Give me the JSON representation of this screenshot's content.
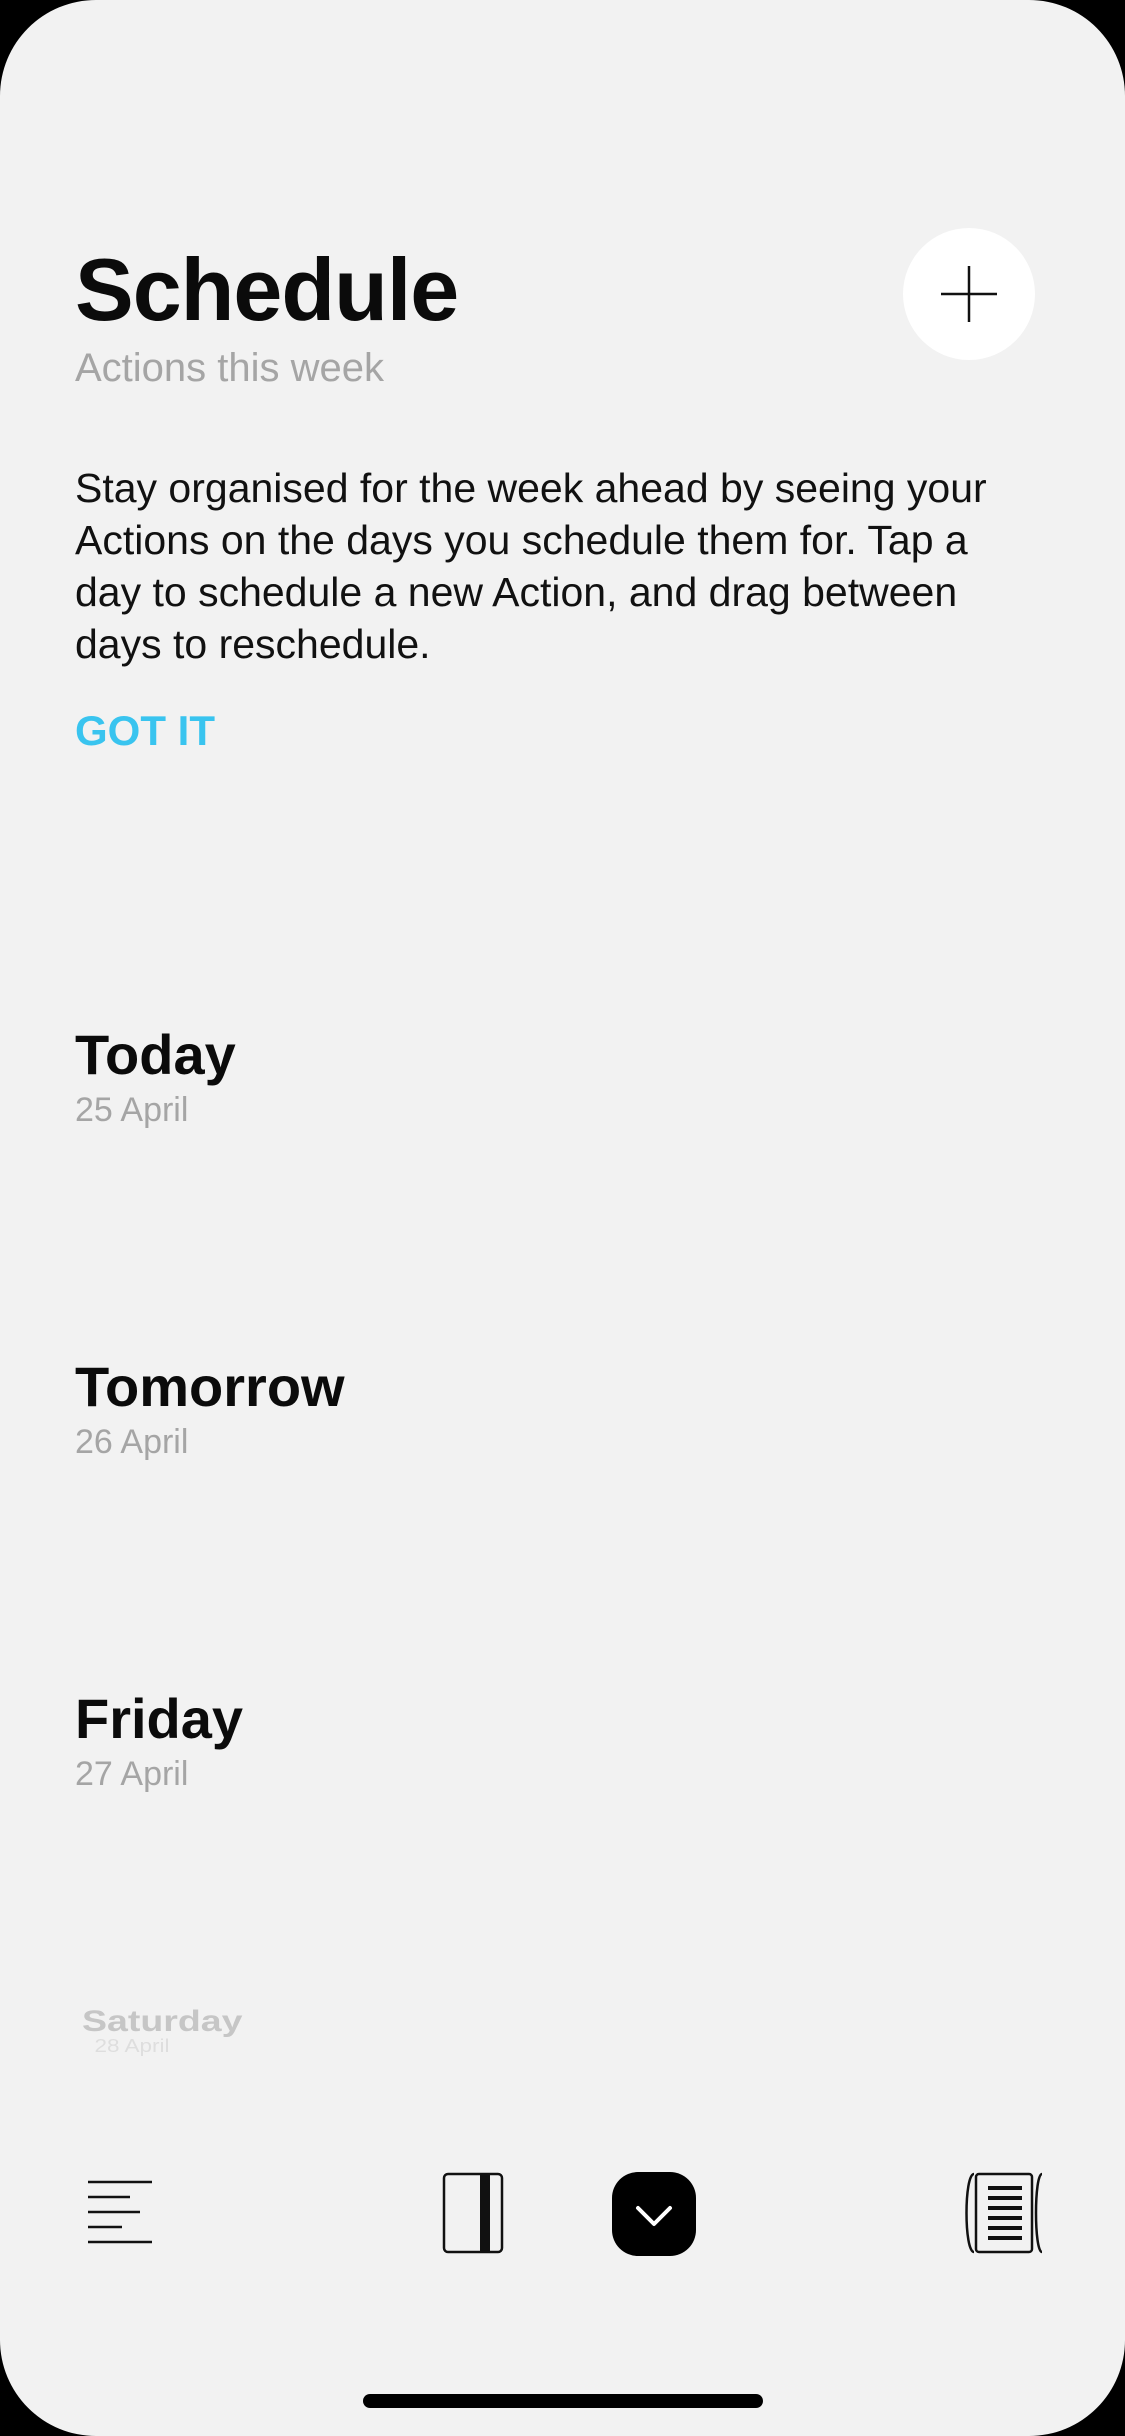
{
  "header": {
    "title": "Schedule",
    "subtitle": "Actions this week",
    "add_icon": "plus-icon"
  },
  "intro": {
    "text": "Stay organised for the week ahead by seeing your Actions on the days you schedule them for. Tap a day to schedule a new Action, and drag between days to reschedule.",
    "dismiss_label": "GOT IT",
    "dismiss_color": "#39c4ef"
  },
  "days": [
    {
      "name": "Today",
      "date": "25 April"
    },
    {
      "name": "Tomorrow",
      "date": "26 April"
    },
    {
      "name": "Friday",
      "date": "27 April"
    },
    {
      "name": "Saturday",
      "date": "28 April"
    }
  ],
  "tabbar": {
    "items": [
      {
        "icon": "list-lines-icon",
        "selected": false
      },
      {
        "icon": "book-panel-icon",
        "selected": false
      },
      {
        "icon": "clock-icon",
        "selected": true
      },
      {
        "icon": "document-stack-icon",
        "selected": false
      }
    ]
  }
}
